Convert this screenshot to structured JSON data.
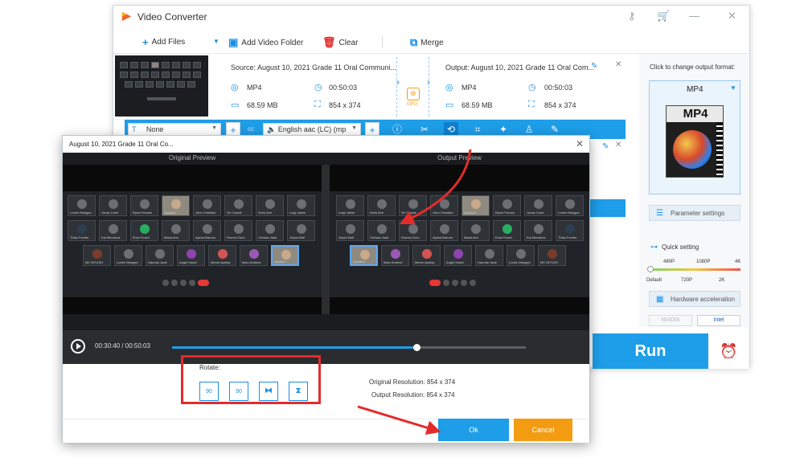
{
  "app": {
    "title": "Video Converter"
  },
  "toolbar": {
    "add_files": "Add Files",
    "add_folder": "Add Video Folder",
    "clear": "Clear",
    "merge": "Merge"
  },
  "file": {
    "source": "Source: August 10, 2021 Grade 11 Oral Communi...",
    "output": "Output: August 10, 2021 Grade 11 Oral Com...",
    "src_format": "MP4",
    "src_duration": "00:50:03",
    "src_size": "68.59 MB",
    "src_resolution": "854 x 374",
    "out_format": "MP4",
    "out_duration": "00:50:03",
    "out_size": "68.59 MB",
    "out_resolution": "854 x 374",
    "gpu_label": "GPU"
  },
  "edit_bar": {
    "subtitle": "None",
    "audio": "English aac (LC) (mp"
  },
  "right_panel": {
    "click_format": "Click to change output format:",
    "format": "MP4",
    "card_label": "MP4",
    "param_settings": "Parameter settings",
    "quick_setting": "Quick setting",
    "q_top": [
      "480P",
      "1080P",
      "4K"
    ],
    "q_bottom": [
      "Default",
      "720P",
      "2K"
    ],
    "hw_accel": "Hardware acceleration",
    "nvidia": "NVIDIA",
    "intel": "Intel",
    "run": "Run"
  },
  "dialog": {
    "title": "August 10, 2021 Grade 11 Oral Co...",
    "original_preview": "Original Preview",
    "output_preview": "Output Preview",
    "time": "00:30:40 / 00:50:03",
    "rotate_label": "Rotate:",
    "rot_left": "90",
    "rot_right": "90",
    "orig_res": "Original Resolution:  854 x 374",
    "out_res": "Output Resolution:  854 x 374",
    "ok": "Ok",
    "cancel": "Cancel"
  },
  "colors": {
    "accent": "#1e9de8",
    "cancel": "#f39c12",
    "highlight": "#e32b2b"
  }
}
